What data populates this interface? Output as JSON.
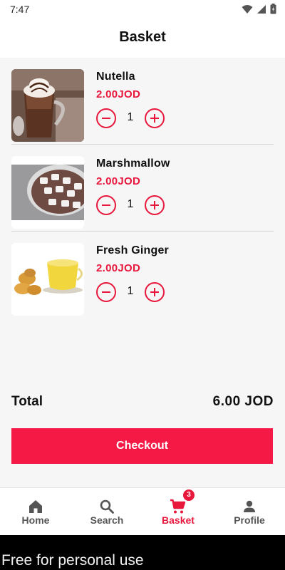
{
  "status_bar": {
    "time": "7:47"
  },
  "header": {
    "title": "Basket"
  },
  "items": [
    {
      "name": "Nutella",
      "price": "2.00JOD",
      "quantity": "1"
    },
    {
      "name": "Marshmallow",
      "price": "2.00JOD",
      "quantity": "1"
    },
    {
      "name": "Fresh Ginger",
      "price": "2.00JOD",
      "quantity": "1"
    }
  ],
  "summary": {
    "total_label": "Total",
    "total_amount": "6.00 JOD"
  },
  "checkout": {
    "label": "Checkout"
  },
  "nav": {
    "items": [
      {
        "label": "Home",
        "icon": "home-icon"
      },
      {
        "label": "Search",
        "icon": "search-icon"
      },
      {
        "label": "Basket",
        "icon": "cart-icon",
        "active": true
      },
      {
        "label": "Profile",
        "icon": "person-icon"
      }
    ],
    "basket_badge": "3"
  },
  "footer": {
    "text": "Free for personal use"
  },
  "colors": {
    "accent": "#e8173c",
    "button": "#f51a45",
    "background": "#f6f6f6"
  }
}
